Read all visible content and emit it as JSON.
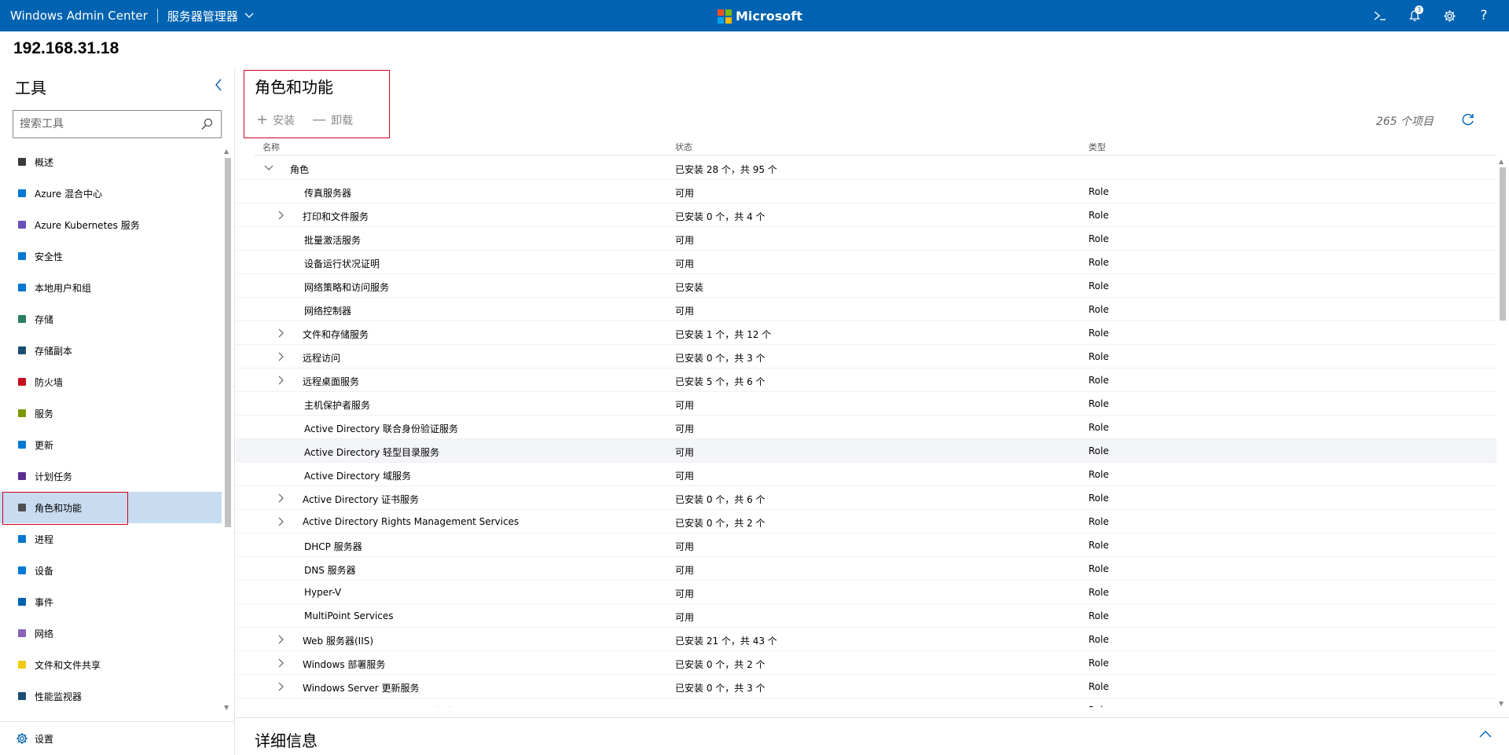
{
  "topbar": {
    "brand": "Windows Admin Center",
    "context": "服务器管理器",
    "microsoft": "Microsoft",
    "notification_count": "3",
    "icons": [
      "powershell-icon",
      "notifications-icon",
      "settings-icon",
      "help-icon"
    ]
  },
  "colors": {
    "accent": "#0063b1",
    "selection": "#c7dcf0",
    "highlight_box": "#d0021b"
  },
  "server": {
    "name": "192.168.31.18"
  },
  "sidebar": {
    "title": "工具",
    "search_placeholder": "搜索工具",
    "items": [
      {
        "label": "概述",
        "icon": "overview-icon"
      },
      {
        "label": "Azure 混合中心",
        "icon": "cloud-icon"
      },
      {
        "label": "Azure Kubernetes 服务",
        "icon": "kubernetes-icon"
      },
      {
        "label": "安全性",
        "icon": "shield-icon"
      },
      {
        "label": "本地用户和组",
        "icon": "users-icon"
      },
      {
        "label": "存储",
        "icon": "storage-icon"
      },
      {
        "label": "存储副本",
        "icon": "storage-replica-icon"
      },
      {
        "label": "防火墙",
        "icon": "firewall-icon"
      },
      {
        "label": "服务",
        "icon": "services-icon"
      },
      {
        "label": "更新",
        "icon": "updates-icon"
      },
      {
        "label": "计划任务",
        "icon": "calendar-icon"
      },
      {
        "label": "角色和功能",
        "icon": "roles-icon",
        "active": true
      },
      {
        "label": "进程",
        "icon": "process-icon"
      },
      {
        "label": "设备",
        "icon": "devices-icon"
      },
      {
        "label": "事件",
        "icon": "events-icon"
      },
      {
        "label": "网络",
        "icon": "network-icon"
      },
      {
        "label": "文件和文件共享",
        "icon": "folder-icon"
      },
      {
        "label": "性能监视器",
        "icon": "performance-icon"
      }
    ],
    "settings_label": "设置"
  },
  "main": {
    "title": "角色和功能",
    "install_label": "安装",
    "uninstall_label": "卸载",
    "item_count": "265 个项目",
    "columns": {
      "name": "名称",
      "state": "状态",
      "type": "类型"
    },
    "rows": [
      {
        "name": "角色",
        "state": "已安装 28 个，共 95 个",
        "type": "",
        "level": 0,
        "chev": "down"
      },
      {
        "name": "传真服务器",
        "state": "可用",
        "type": "Role",
        "level": 1,
        "chev": ""
      },
      {
        "name": "打印和文件服务",
        "state": "已安装 0 个，共 4 个",
        "type": "Role",
        "level": 1,
        "chev": "right"
      },
      {
        "name": "批量激活服务",
        "state": "可用",
        "type": "Role",
        "level": 1,
        "chev": ""
      },
      {
        "name": "设备运行状况证明",
        "state": "可用",
        "type": "Role",
        "level": 1,
        "chev": ""
      },
      {
        "name": "网络策略和访问服务",
        "state": "已安装",
        "type": "Role",
        "level": 1,
        "chev": ""
      },
      {
        "name": "网络控制器",
        "state": "可用",
        "type": "Role",
        "level": 1,
        "chev": ""
      },
      {
        "name": "文件和存储服务",
        "state": "已安装 1 个，共 12 个",
        "type": "Role",
        "level": 1,
        "chev": "right"
      },
      {
        "name": "远程访问",
        "state": "已安装 0 个，共 3 个",
        "type": "Role",
        "level": 1,
        "chev": "right"
      },
      {
        "name": "远程桌面服务",
        "state": "已安装 5 个，共 6 个",
        "type": "Role",
        "level": 1,
        "chev": "right"
      },
      {
        "name": "主机保护者服务",
        "state": "可用",
        "type": "Role",
        "level": 1,
        "chev": ""
      },
      {
        "name": "Active Directory 联合身份验证服务",
        "state": "可用",
        "type": "Role",
        "level": 1,
        "chev": ""
      },
      {
        "name": "Active Directory 轻型目录服务",
        "state": "可用",
        "type": "Role",
        "level": 1,
        "chev": "",
        "highlight": true
      },
      {
        "name": "Active Directory 域服务",
        "state": "可用",
        "type": "Role",
        "level": 1,
        "chev": ""
      },
      {
        "name": "Active Directory 证书服务",
        "state": "已安装 0 个，共 6 个",
        "type": "Role",
        "level": 1,
        "chev": "right"
      },
      {
        "name": "Active Directory Rights Management Services",
        "state": "已安装 0 个，共 2 个",
        "type": "Role",
        "level": 1,
        "chev": "right"
      },
      {
        "name": "DHCP 服务器",
        "state": "可用",
        "type": "Role",
        "level": 1,
        "chev": ""
      },
      {
        "name": "DNS 服务器",
        "state": "可用",
        "type": "Role",
        "level": 1,
        "chev": ""
      },
      {
        "name": "Hyper-V",
        "state": "可用",
        "type": "Role",
        "level": 1,
        "chev": ""
      },
      {
        "name": "MultiPoint Services",
        "state": "可用",
        "type": "Role",
        "level": 1,
        "chev": ""
      },
      {
        "name": "Web 服务器(IIS)",
        "state": "已安装 21 个，共 43 个",
        "type": "Role",
        "level": 1,
        "chev": "right"
      },
      {
        "name": "Windows 部署服务",
        "state": "已安装 0 个，共 2 个",
        "type": "Role",
        "level": 1,
        "chev": "right"
      },
      {
        "name": "Windows Server 更新服务",
        "state": "已安装 0 个，共 3 个",
        "type": "Role",
        "level": 1,
        "chev": "right"
      },
      {
        "name": "Windows Server Essentials 体验",
        "state": "可用",
        "type": "Role",
        "level": 1,
        "chev": ""
      }
    ],
    "details_title": "详细信息"
  }
}
